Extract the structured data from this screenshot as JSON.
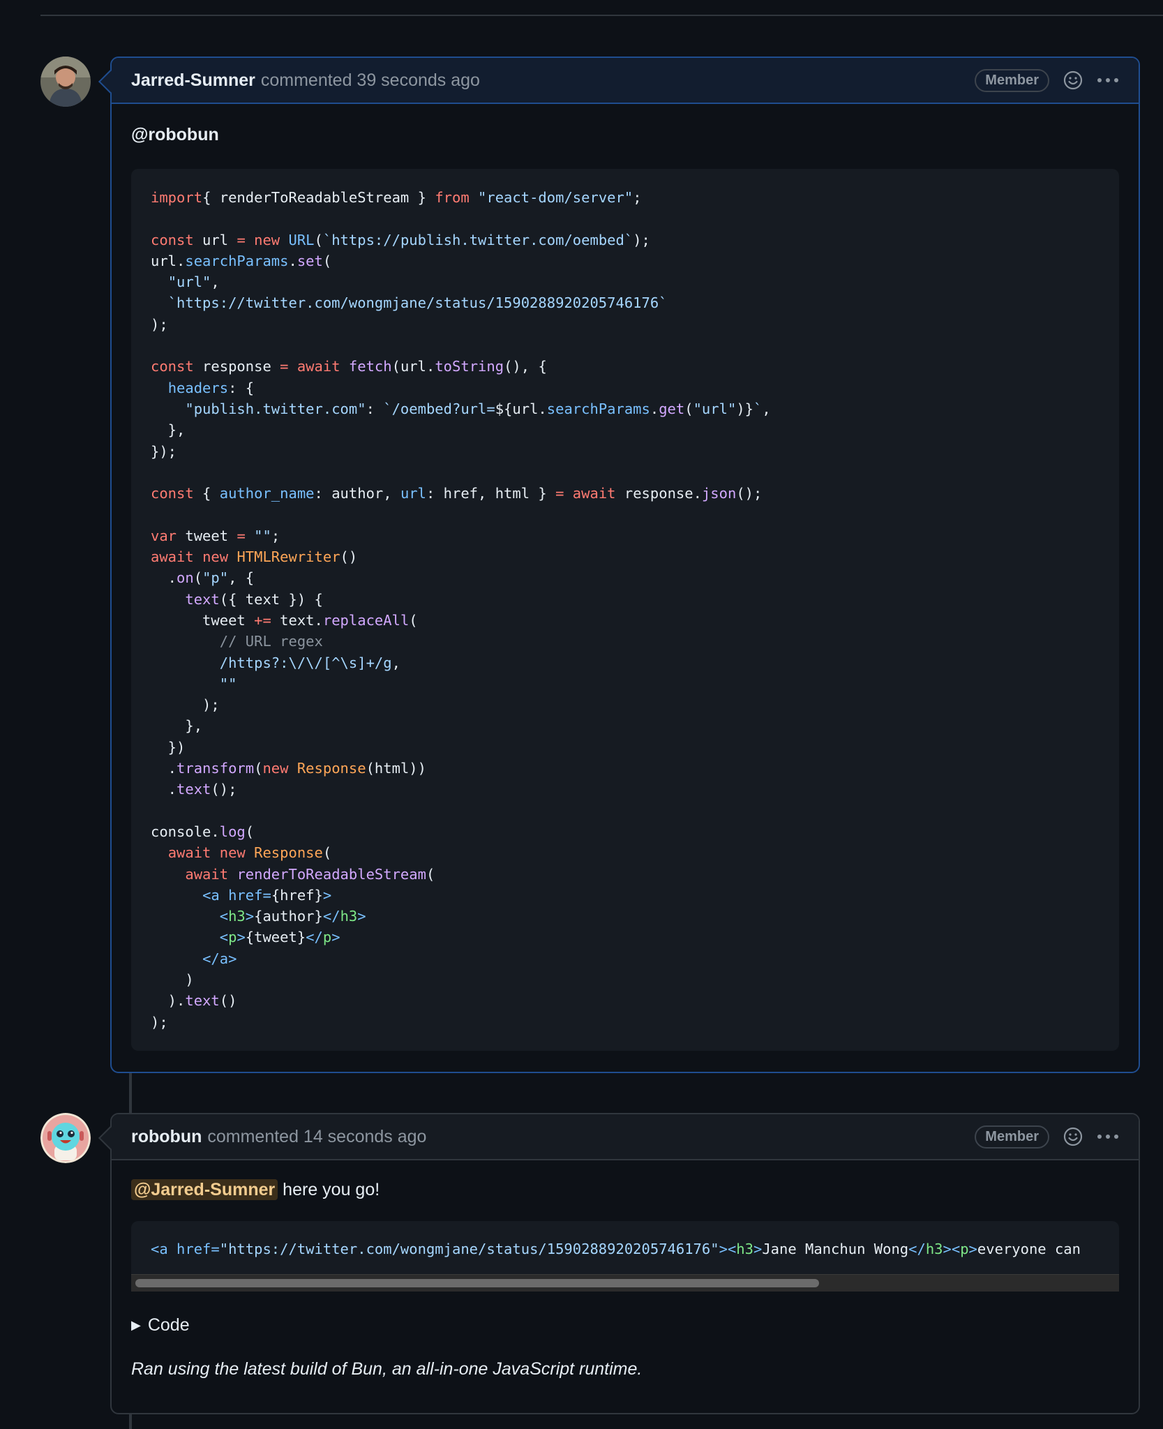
{
  "comments": [
    {
      "author": "Jarred-Sumner",
      "meta": "commented 39 seconds ago",
      "badge": "Member",
      "mention": "@robobun"
    },
    {
      "author": "robobun",
      "meta": "commented 14 seconds ago",
      "badge": "Member",
      "mention": "@Jarred-Sumner",
      "reply": " here you go!",
      "details_label": "Code",
      "footer": "Ran using the latest build of Bun, an all-in-one JavaScript runtime."
    }
  ],
  "code_lines": [
    [
      [
        "kw",
        "import"
      ],
      [
        "",
        "{ renderToReadableStream } "
      ],
      [
        "kw",
        "from"
      ],
      [
        "",
        ""
      ],
      [
        "str",
        " \"react-dom/server\""
      ],
      [
        "",
        ";"
      ]
    ],
    [],
    [
      [
        "kw",
        "const"
      ],
      [
        "",
        " url "
      ],
      [
        "kw",
        "="
      ],
      [
        "",
        " "
      ],
      [
        "kw",
        "new"
      ],
      [
        "",
        " "
      ],
      [
        "prop",
        "URL"
      ],
      [
        "",
        "("
      ],
      [
        "str",
        "`https://publish.twitter.com/oembed`"
      ],
      [
        "",
        ");"
      ]
    ],
    [
      [
        "",
        "url."
      ],
      [
        "prop",
        "searchParams"
      ],
      [
        "",
        "."
      ],
      [
        "fn",
        "set"
      ],
      [
        "",
        "("
      ]
    ],
    [
      [
        "",
        "  "
      ],
      [
        "str",
        "\"url\""
      ],
      [
        "",
        ","
      ]
    ],
    [
      [
        "",
        "  "
      ],
      [
        "str",
        "`https://twitter.com/wongmjane/status/1590288920205746176`"
      ]
    ],
    [
      [
        "",
        ");"
      ]
    ],
    [],
    [
      [
        "kw",
        "const"
      ],
      [
        "",
        " response "
      ],
      [
        "kw",
        "="
      ],
      [
        "",
        " "
      ],
      [
        "kw",
        "await"
      ],
      [
        "",
        " "
      ],
      [
        "fn",
        "fetch"
      ],
      [
        "",
        "(url."
      ],
      [
        "fn",
        "toString"
      ],
      [
        "",
        "(), {"
      ]
    ],
    [
      [
        "",
        "  "
      ],
      [
        "prop",
        "headers"
      ],
      [
        "",
        ": {"
      ]
    ],
    [
      [
        "",
        "    "
      ],
      [
        "str",
        "\"publish.twitter.com\""
      ],
      [
        "",
        ": "
      ],
      [
        "str",
        "`/oembed?url="
      ],
      [
        "",
        "${url."
      ],
      [
        "prop",
        "searchParams"
      ],
      [
        "",
        "."
      ],
      [
        "fn",
        "get"
      ],
      [
        "",
        "("
      ],
      [
        "str",
        "\"url\""
      ],
      [
        "",
        ")}"
      ],
      [
        "str",
        "`"
      ],
      [
        "",
        ","
      ]
    ],
    [
      [
        "",
        "  },"
      ]
    ],
    [
      [
        "",
        "});"
      ]
    ],
    [],
    [
      [
        "kw",
        "const"
      ],
      [
        "",
        "",
        " "
      ],
      [
        "",
        " { "
      ],
      [
        "prop",
        "author_name"
      ],
      [
        "",
        ": author, "
      ],
      [
        "prop",
        "url"
      ],
      [
        "",
        ": href, html } "
      ],
      [
        "kw",
        "="
      ],
      [
        "",
        " "
      ],
      [
        "kw",
        "await"
      ],
      [
        "",
        " response."
      ],
      [
        "fn",
        "json"
      ],
      [
        "",
        "();"
      ]
    ],
    [],
    [
      [
        "kw",
        "var"
      ],
      [
        "",
        " tweet "
      ],
      [
        "kw",
        "="
      ],
      [
        "",
        " "
      ],
      [
        "str",
        "\"\""
      ],
      [
        "",
        ";"
      ]
    ],
    [
      [
        "kw",
        "await"
      ],
      [
        "",
        " "
      ],
      [
        "kw",
        "new"
      ],
      [
        "",
        " "
      ],
      [
        "cls",
        "HTMLRewriter"
      ],
      [
        "",
        "()"
      ]
    ],
    [
      [
        "",
        "  ."
      ],
      [
        "fn",
        "on"
      ],
      [
        "",
        "("
      ],
      [
        "str",
        "\"p\""
      ],
      [
        "",
        ", {"
      ]
    ],
    [
      [
        "",
        "    "
      ],
      [
        "fn",
        "text"
      ],
      [
        "",
        "({ text }) {"
      ]
    ],
    [
      [
        "",
        "      tweet "
      ],
      [
        "kw",
        "+="
      ],
      [
        "",
        " text."
      ],
      [
        "fn",
        "replaceAll"
      ],
      [
        "",
        "("
      ]
    ],
    [
      [
        "",
        "        "
      ],
      [
        "cm",
        "// URL regex"
      ]
    ],
    [
      [
        "",
        "        "
      ],
      [
        "str",
        "/https?:\\/\\/[^\\s]+/g"
      ],
      [
        "",
        ","
      ]
    ],
    [
      [
        "",
        "        "
      ],
      [
        "str",
        "\"\""
      ]
    ],
    [
      [
        "",
        "      );"
      ]
    ],
    [
      [
        "",
        "    },"
      ]
    ],
    [
      [
        "",
        "  })"
      ]
    ],
    [
      [
        "",
        "  ."
      ],
      [
        "fn",
        "transform"
      ],
      [
        "",
        "("
      ],
      [
        "kw",
        "new"
      ],
      [
        "",
        " "
      ],
      [
        "cls",
        "Response"
      ],
      [
        "",
        "(html))"
      ]
    ],
    [
      [
        "",
        "  ."
      ],
      [
        "fn",
        "text"
      ],
      [
        "",
        "();"
      ]
    ],
    [],
    [
      [
        "",
        "console."
      ],
      [
        "fn",
        "log"
      ],
      [
        "",
        "("
      ]
    ],
    [
      [
        "",
        "  "
      ],
      [
        "kw",
        "await"
      ],
      [
        "",
        " "
      ],
      [
        "kw",
        "new"
      ],
      [
        "",
        " "
      ],
      [
        "cls",
        "Response"
      ],
      [
        "",
        "("
      ]
    ],
    [
      [
        "",
        "    "
      ],
      [
        "kw",
        "await"
      ],
      [
        "",
        " "
      ],
      [
        "fn",
        "renderToReadableStream"
      ],
      [
        "",
        "("
      ]
    ],
    [
      [
        "",
        "      "
      ],
      [
        "prop",
        "<a"
      ],
      [
        "",
        " "
      ],
      [
        "prop",
        "href="
      ],
      [
        "",
        "{href}"
      ],
      [
        "prop",
        ">"
      ]
    ],
    [
      [
        "",
        "        "
      ],
      [
        "prop",
        "<"
      ],
      [
        "tag",
        "h3"
      ],
      [
        "prop",
        ">"
      ],
      [
        "",
        "{author}"
      ],
      [
        "prop",
        "</"
      ],
      [
        "tag",
        "h3"
      ],
      [
        "prop",
        ">"
      ]
    ],
    [
      [
        "",
        "        "
      ],
      [
        "prop",
        "<"
      ],
      [
        "tag",
        "p"
      ],
      [
        "prop",
        ">"
      ],
      [
        "",
        "{tweet}"
      ],
      [
        "prop",
        "</"
      ],
      [
        "tag",
        "p"
      ],
      [
        "prop",
        ">"
      ]
    ],
    [
      [
        "",
        "      "
      ],
      [
        "prop",
        "</a>"
      ]
    ],
    [
      [
        "",
        "    )"
      ]
    ],
    [
      [
        "",
        "  )."
      ],
      [
        "fn",
        "text"
      ],
      [
        "",
        "()"
      ]
    ],
    [
      [
        "",
        ");"
      ]
    ]
  ],
  "output_line": [
    [
      "prop",
      "<a"
    ],
    [
      "",
      " "
    ],
    [
      "prop",
      "href="
    ],
    [
      "str",
      "\"https://twitter.com/wongmjane/status/1590288920205746176\""
    ],
    [
      "prop",
      ">"
    ],
    [
      "prop",
      "<"
    ],
    [
      "tag",
      "h3"
    ],
    [
      "prop",
      ">"
    ],
    [
      "",
      "Jane Manchun Wong"
    ],
    [
      "prop",
      "</"
    ],
    [
      "tag",
      "h3"
    ],
    [
      "prop",
      ">"
    ],
    [
      "prop",
      "<"
    ],
    [
      "tag",
      "p"
    ],
    [
      "prop",
      ">"
    ],
    [
      "",
      "everyone can"
    ]
  ],
  "icons": {
    "reaction": "smiley-icon",
    "more": "kebab-icon",
    "details": "triangle-right-icon"
  }
}
